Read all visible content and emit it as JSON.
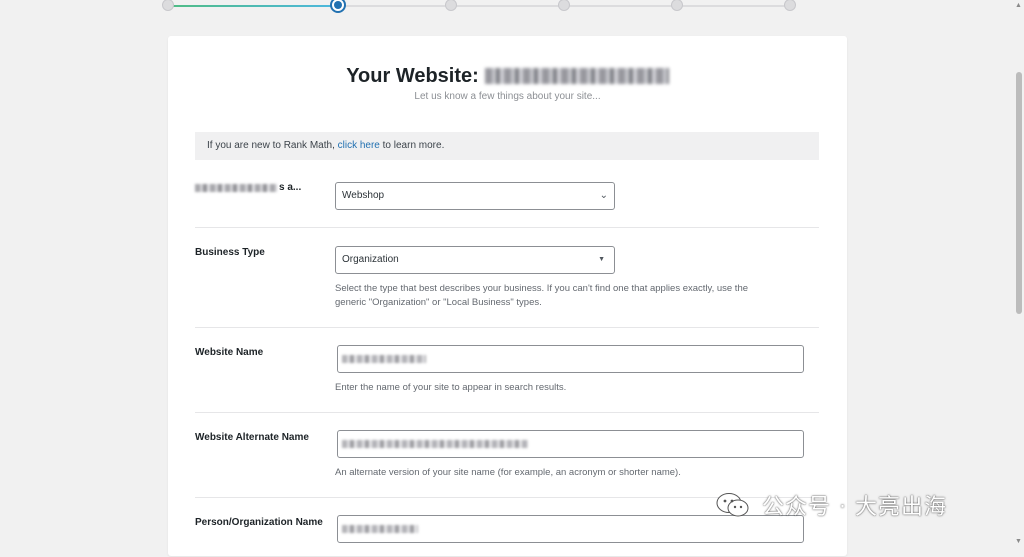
{
  "stepper": {
    "steps": 6,
    "active_index": 1,
    "progress_fraction": 0.27
  },
  "header": {
    "title": "Your Website:",
    "subtitle": "Let us know a few things about your site..."
  },
  "notice": {
    "prefix": "If you are new to Rank Math,",
    "link": "click here",
    "suffix": "to learn more."
  },
  "fields": {
    "site_type": {
      "label_suffix": "s a...",
      "value": "Webshop"
    },
    "business_type": {
      "label": "Business Type",
      "value": "Organization",
      "help_line1": "Select the type that best describes your business. If you can't find one that applies exactly, use the",
      "help_line2": "generic \"Organization\" or \"Local Business\" types."
    },
    "website_name": {
      "label": "Website Name",
      "help": "Enter the name of your site to appear in search results."
    },
    "website_alternate_name": {
      "label": "Website Alternate Name",
      "help": "An alternate version of your site name (for example, an acronym or shorter name)."
    },
    "person_org_name": {
      "label": "Person/Organization Name"
    }
  },
  "watermark": {
    "text": "公众号 · 大亮出海",
    "icon": "wechat-icon"
  },
  "colors": {
    "accent": "#2271b1",
    "progress_start": "#50bc84",
    "link": "#2271b1"
  }
}
